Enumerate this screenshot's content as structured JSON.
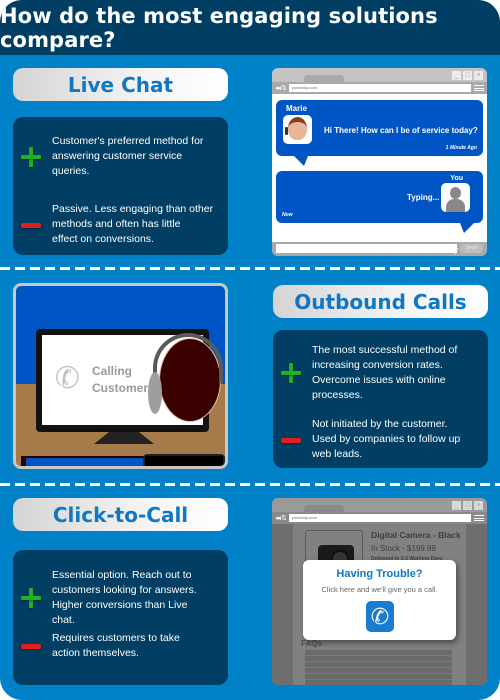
{
  "header": {
    "title": "How do the most engaging solutions compare?"
  },
  "sections": [
    {
      "title": "Live Chat",
      "pros": "Customer's preferred method for\nanswering customer service\nqueries.",
      "cons": "Passive. Less engaging than other\nmethods and often has little\neffect on conversions."
    },
    {
      "title": "Outbound Calls",
      "pros": "The most successful method of\nincreasing conversion rates.\nOvercome issues with online\nprocesses.",
      "cons": "Not initiated by the customer.\nUsed by companies to follow up\nweb leads."
    },
    {
      "title": "Click-to-Call",
      "pros": "Essential option. Reach out to\ncustomers looking for answers.\nHigher conversions than Live\nchat.",
      "cons": "Requires customers to take\naction themselves."
    }
  ],
  "chat_mockup": {
    "url": "yourshop.com",
    "agent_name": "Marie",
    "agent_message": "Hi There! How can I be of service today?",
    "agent_time": "1 Minute Ago",
    "user_name": "You",
    "user_message": "Typing...",
    "user_time": "Now",
    "send_label": "Send"
  },
  "outbound_mockup": {
    "screen_text": "Calling\nCustomer..."
  },
  "c2c_mockup": {
    "url": "yourshop.com",
    "product_name": "Digital Camera - Black",
    "product_stock": "In Stock - $199.99",
    "product_delivery": "Delivered in 2-3 Working Days",
    "popup_title": "Having Trouble?",
    "popup_text": "Click here and we'll give you a call.",
    "faq_label": "FAQs"
  },
  "colors": {
    "background": "#0081c8",
    "header": "#003f63",
    "box": "#003f63",
    "title_text": "#1177c2",
    "plus": "#1fb31f",
    "minus": "#e02020",
    "bubble": "#0055c4"
  }
}
